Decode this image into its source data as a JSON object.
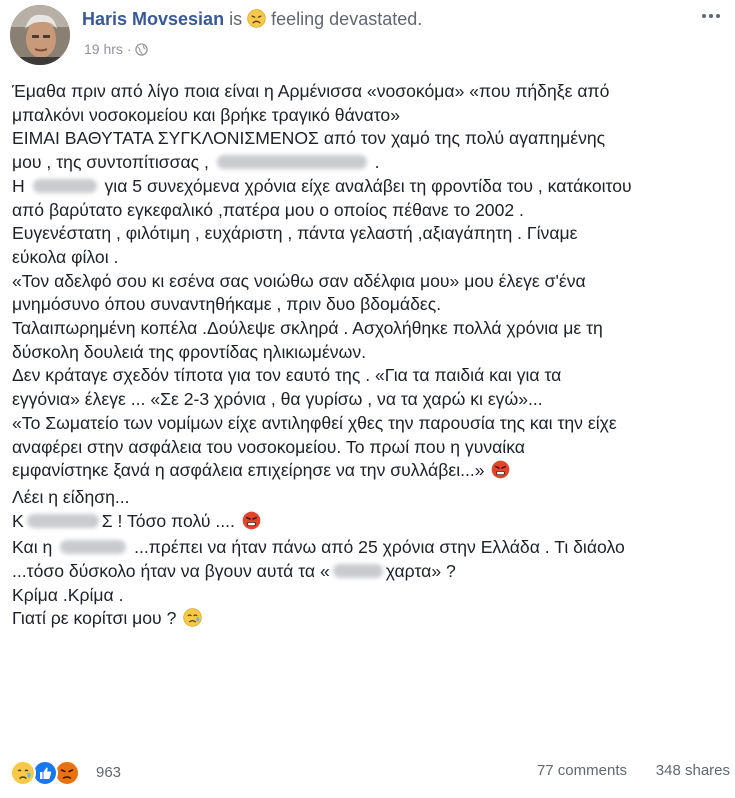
{
  "post": {
    "author": "Haris Movsesian",
    "activity_prefix": "is",
    "feeling": "feeling devastated.",
    "time": "19 hrs",
    "separator": "·"
  },
  "body": {
    "l1": "Έμαθα πριν από λίγο ποια είναι η Αρμένισσα «νοσοκόμα» «που πήδηξε από",
    "l2": "μπαλκόνι νοσοκομείου και βρήκε τραγικό θάνατο»",
    "l3": "ΕΙΜΑΙ ΒΑΘΥΤΑΤΑ ΣΥΓΚΛΟΝΙΣΜΕΝΟΣ από τον χαμό της πολύ αγαπημένης",
    "l4a": "μου , της συντοπίτισσας ,",
    "l4b": ".",
    "l5a": "Η",
    "l5b": "για 5 συνεχόμενα χρόνια είχε αναλάβει τη φροντίδα του , κατάκοιτου",
    "l6": "από βαρύτατο εγκεφαλικό ,πατέρα μου ο οποίος πέθανε το 2002 .",
    "l7": "Ευγενέστατη , φιλότιμη , ευχάριστη , πάντα γελαστή ,αξιαγάπητη . Γίναμε",
    "l8": "εύκολα φίλοι .",
    "l9": "«Τον αδελφό σου κι εσένα σας νοιώθω σαν αδέλφια μου» μου έλεγε σ'ένα",
    "l10": "μνημόσυνο όπου συναντηθήκαμε , πριν δυο βδομάδες.",
    "l11": "Ταλαιπωρημένη κοπέλα .Δούλεψε σκληρά . Ασχολήθηκε πολλά χρόνια με τη",
    "l12": "δύσκολη δουλειά της φροντίδας ηλικιωμένων.",
    "l13": "Δεν κράταγε σχεδόν τίποτα για τον εαυτό της . «Για τα παιδιά και για τα",
    "l14": "εγγόνια» έλεγε ... «Σε 2-3 χρόνια , θα γυρίσω , να τα χαρώ κι εγώ»...",
    "l15": "«Το Σωματείο των νομίμων είχε αντιληφθεί χθες την παρουσία της και την είχε",
    "l16": "αναφέρει στην ασφάλεια του νοσοκομείου. Το πρωί που η γυναίκα",
    "l17": "εμφανίστηκε ξανά η ασφάλεια επιχείρησε να την συλλάβει...»",
    "l18": "Λέει η είδηση...",
    "l19a": "Κ",
    "l19b": "Σ ! Τόσο πολύ ....",
    "l20a": "Και η",
    "l20b": "...πρέπει να ήταν πάνω από 25 χρόνια στην Ελλάδα . Τι διάολο",
    "l21a": "...τόσο δύσκολο ήταν να βγουν αυτά τα «",
    "l21b": "χαρτα» ?",
    "l22": "Κρίμα .Κρίμα .",
    "l23": "Γιατί ρε κορίτσι μου ?"
  },
  "footer": {
    "reactions_count": "963",
    "comments": "77 comments",
    "shares": "348 shares"
  },
  "icons": {
    "feeling": "sad-face-emoji",
    "privacy": "globe-icon",
    "options": "more-options-icon",
    "angry": "angry-face-emoji",
    "crying": "crying-face-emoji",
    "reactions": [
      "sad-reaction",
      "like-reaction",
      "angry-reaction"
    ]
  },
  "colors": {
    "author": "#385898",
    "meta": "#90949c",
    "like": "#1877f2",
    "angry": "#e9710f",
    "emoji_yellow": "#f7c948"
  }
}
